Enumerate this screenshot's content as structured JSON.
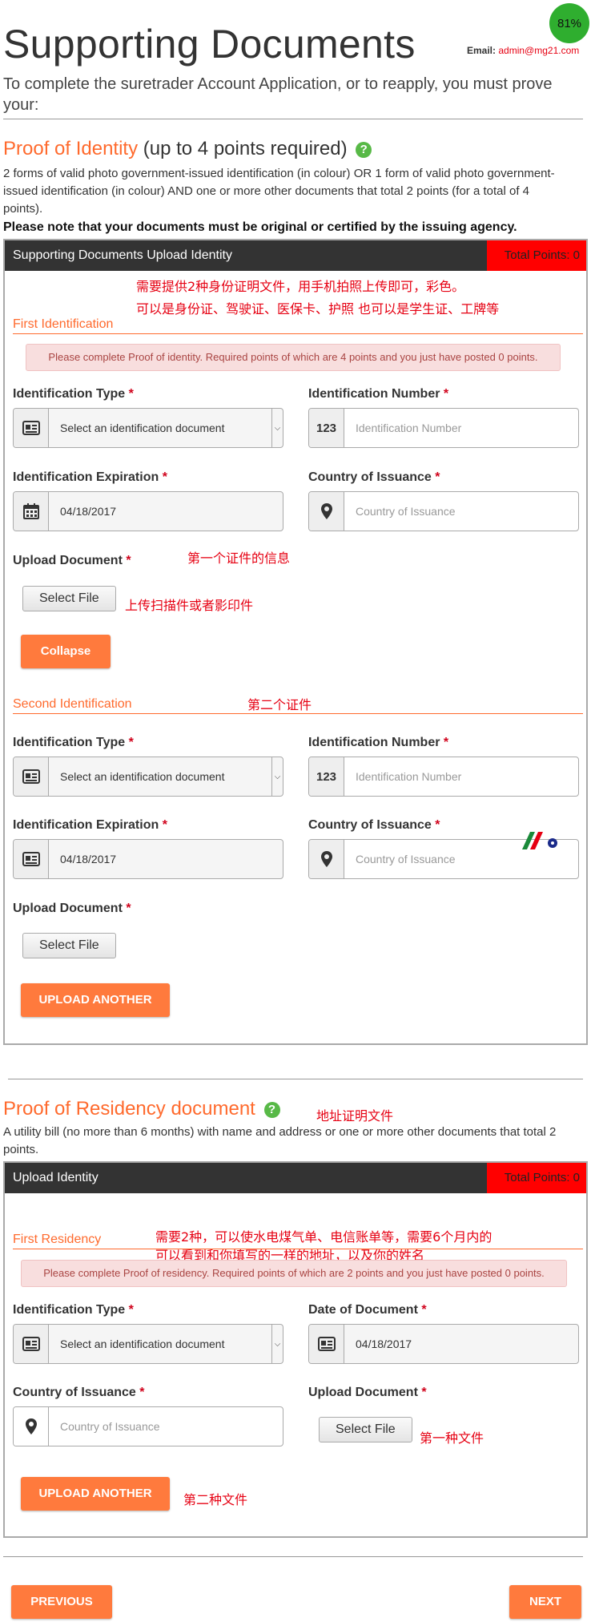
{
  "header": {
    "title": "Supporting Documents",
    "email_label": "Email:",
    "email_value": "admin@mg21.com",
    "progress": "81%",
    "intro": "To complete the suretrader Account Application, or to reapply, you must prove your:"
  },
  "identity": {
    "heading": "Proof of Identity",
    "heading_sub": "(up to 4 points required)",
    "help_icon": "?",
    "description": "2 forms of valid photo government-issued identification (in colour) OR 1 form of valid photo government-issued identification (in colour) AND one or more other documents that total 2 points (for a total of 4 points).",
    "note": "Please note that your documents must be original or certified by the issuing agency.",
    "panel_title": "Supporting Documents Upload Identity",
    "total_points": "Total Points: 0",
    "annotation_line1": "需要提供2种身份证明文件，用手机拍照上传即可，彩色。",
    "annotation_line2": "可以是身份证、驾驶证、医保卡、护照   也可以是学生证、工牌等",
    "first": {
      "heading": "First Identification",
      "alert": "Please complete Proof of identity. Required points of which are 4 points and you just have posted 0 points.",
      "id_type_label": "Identification Type",
      "id_type_value": "Select an identification document",
      "id_number_label": "Identification Number",
      "id_number_addon": "123",
      "id_number_placeholder": "Identification Number",
      "expiration_label": "Identification Expiration",
      "expiration_value": "04/18/2017",
      "country_label": "Country of Issuance",
      "country_placeholder": "Country of Issuance",
      "upload_label": "Upload Document",
      "select_file": "Select File",
      "annotation_info": "第一个证件的信息",
      "annotation_upload": "上传扫描件或者影印件",
      "collapse": "Collapse"
    },
    "second": {
      "heading": "Second Identification",
      "annotation": "第二个证件",
      "id_type_label": "Identification Type",
      "id_type_value": "Select an identification document",
      "id_number_label": "Identification Number",
      "id_number_addon": "123",
      "id_number_placeholder": "Identification Number",
      "expiration_label": "Identification Expiration",
      "expiration_value": "04/18/2017",
      "country_label": "Country of Issuance",
      "country_placeholder": "Country of Issuance",
      "upload_label": "Upload Document",
      "select_file": "Select File",
      "upload_another": "UPLOAD ANOTHER"
    }
  },
  "residency": {
    "heading": "Proof of Residency document",
    "help_icon": "?",
    "annotation_heading": "地址证明文件",
    "description": "A utility bill (no more than 6 months) with name and address or one or more other documents that total 2 points.",
    "panel_title": "Upload Identity",
    "total_points": "Total Points: 0",
    "first": {
      "heading": "First Residency",
      "annotation_line1": "需要2种，可以使水电煤气单、电信账单等，需要6个月内的",
      "annotation_line2": "可以看到和你填写的一样的地址，以及你的姓名",
      "alert": "Please complete Proof of residency. Required points of which are 2 points and you just have posted 0 points.",
      "id_type_label": "Identification Type",
      "id_type_value": "Select an identification document",
      "date_label": "Date of Document",
      "date_value": "04/18/2017",
      "country_label": "Country of Issuance",
      "country_placeholder": "Country of Issuance",
      "upload_label": "Upload Document",
      "select_file": "Select File",
      "annotation_file1": "第一种文件",
      "upload_another": "UPLOAD ANOTHER",
      "annotation_file2": "第二种文件"
    }
  },
  "nav": {
    "previous": "PREVIOUS",
    "next": "NEXT"
  },
  "colors": {
    "accent": "#ff7a3d",
    "panel_header": "#333333",
    "points_bg": "#ff0000",
    "progress_green": "#2fae2f",
    "annotation_red": "#e60012"
  }
}
